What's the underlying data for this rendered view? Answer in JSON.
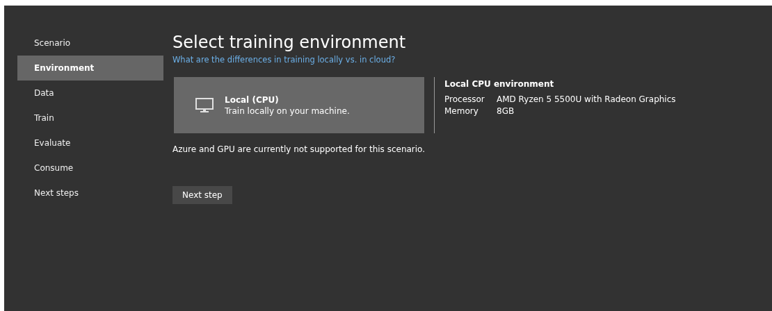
{
  "sidebar": {
    "items": [
      {
        "label": "Scenario",
        "selected": false
      },
      {
        "label": "Environment",
        "selected": true
      },
      {
        "label": "Data",
        "selected": false
      },
      {
        "label": "Train",
        "selected": false
      },
      {
        "label": "Evaluate",
        "selected": false
      },
      {
        "label": "Consume",
        "selected": false
      },
      {
        "label": "Next steps",
        "selected": false
      }
    ]
  },
  "title": "Select training environment",
  "help_link": "What are the differences in training locally vs. in cloud?",
  "options": [
    {
      "title": "Local (CPU)",
      "description": "Train locally on your machine.",
      "selected": true
    }
  ],
  "details": {
    "title": "Local CPU environment",
    "rows": [
      {
        "label": "Processor",
        "value": "AMD Ryzen 5 5500U with Radeon Graphics"
      },
      {
        "label": "Memory",
        "value": "8GB"
      }
    ]
  },
  "note": "Azure and GPU are currently not supported for this scenario.",
  "next_button": "Next step"
}
